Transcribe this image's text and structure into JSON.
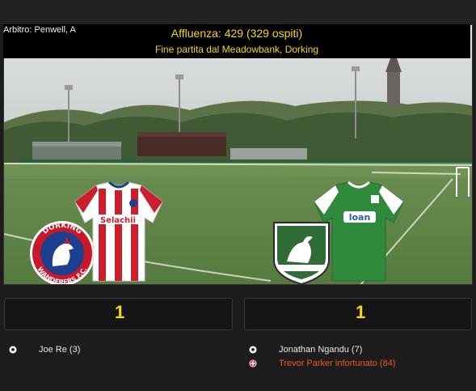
{
  "match": {
    "referee": "Arbitro: Penwell, A",
    "attendance": "Affluenza: 429 (329 ospiti)",
    "venue": "Fine partita dal Meadowbank, Dorking"
  },
  "home": {
    "club": "DORKING WANDERERS F.C.",
    "sponsor": "Selachii",
    "score": "1",
    "events": [
      {
        "icon": "ball-icon",
        "text": "Joe Re (3)"
      }
    ]
  },
  "away": {
    "sponsor": "loan",
    "score": "1",
    "events": [
      {
        "icon": "ball-icon",
        "text": "Jonathan Ngandu (7)"
      },
      {
        "icon": "injury-icon",
        "text": "Trevor Parker infortunato (84)"
      }
    ]
  },
  "colors": {
    "accent": "#f5d90a",
    "injury": "#e85a2a",
    "text": "#e8e8e8",
    "home_kit": "#cc1f2d",
    "away_kit": "#2f8a3c"
  }
}
